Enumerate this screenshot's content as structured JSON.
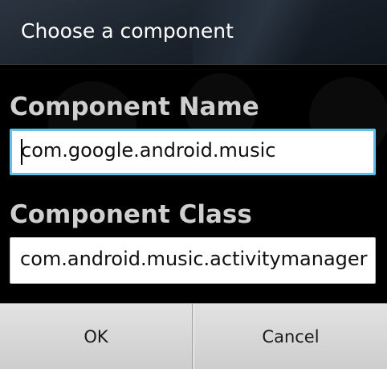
{
  "dialog": {
    "title": "Choose a component"
  },
  "component_name": {
    "label": "Component Name",
    "value": "com.google.android.music"
  },
  "component_class": {
    "label": "Component Class",
    "value": "com.android.music.activitymanager"
  },
  "buttons": {
    "ok": "OK",
    "cancel": "Cancel"
  },
  "colors": {
    "focus_border": "#5fc3e8",
    "title_bar": "#1b232d"
  }
}
